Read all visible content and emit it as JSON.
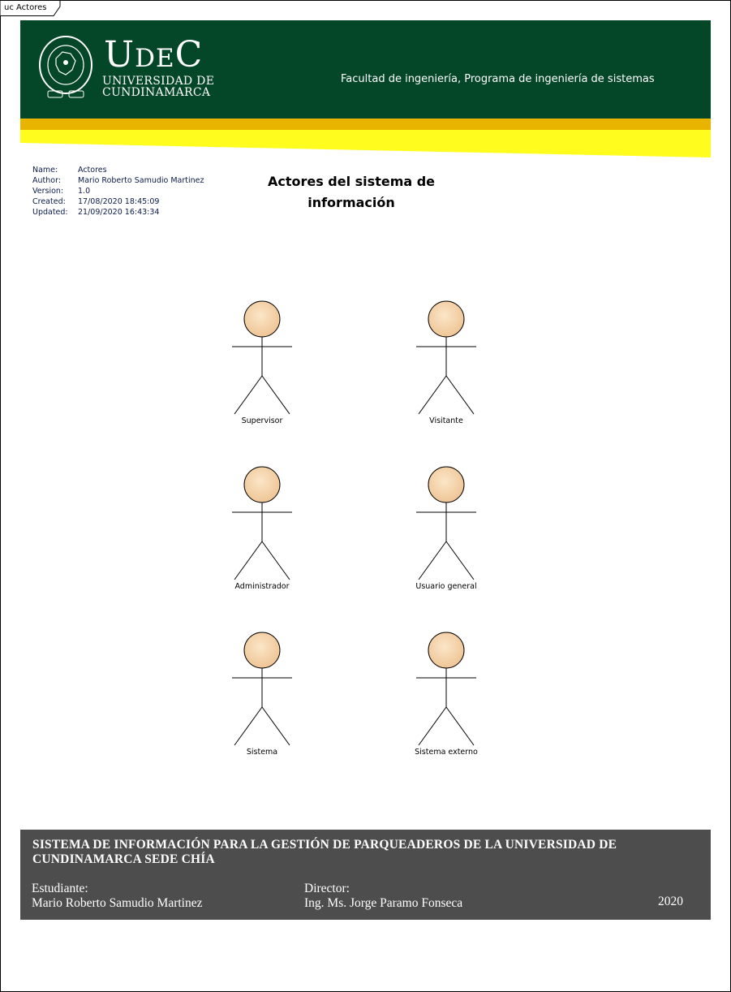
{
  "diagram_tab": "uc Actores",
  "header": {
    "logo_main": "UDEC",
    "logo_line1": "UNIVERSIDAD DE",
    "logo_line2": "CUNDINAMARCA",
    "faculty": "Facultad de ingeniería, Programa de ingeniería de sistemas",
    "colors": {
      "banner": "#044628",
      "gold": "#e8b400",
      "yellow": "#fffc1e"
    }
  },
  "meta": [
    {
      "key": "Name:",
      "value": "Actores"
    },
    {
      "key": "Author:",
      "value": "Mario Roberto Samudio Martinez"
    },
    {
      "key": "Version:",
      "value": "1.0"
    },
    {
      "key": "Created:",
      "value": "17/08/2020 18:45:09"
    },
    {
      "key": "Updated:",
      "value": "21/09/2020 16:43:34"
    }
  ],
  "title": "Actores del sistema de información",
  "actors": [
    {
      "name": "Supervisor"
    },
    {
      "name": "Visitante"
    },
    {
      "name": "Administrador"
    },
    {
      "name": "Usuario general"
    },
    {
      "name": "Sistema"
    },
    {
      "name": "Sistema externo"
    }
  ],
  "actor_colors": {
    "head_light": "#fbe6c8",
    "head_dark": "#efc596"
  },
  "footer": {
    "title": "SISTEMA DE INFORMACIÓN PARA LA GESTIÓN DE PARQUEADEROS DE LA UNIVERSIDAD DE CUNDINAMARCA SEDE CHÍA",
    "student_label": "Estudiante:",
    "student_name": "Mario Roberto Samudio Martinez",
    "director_label": "Director:",
    "director_name": "Ing. Ms. Jorge Paramo Fonseca",
    "year": "2020"
  }
}
